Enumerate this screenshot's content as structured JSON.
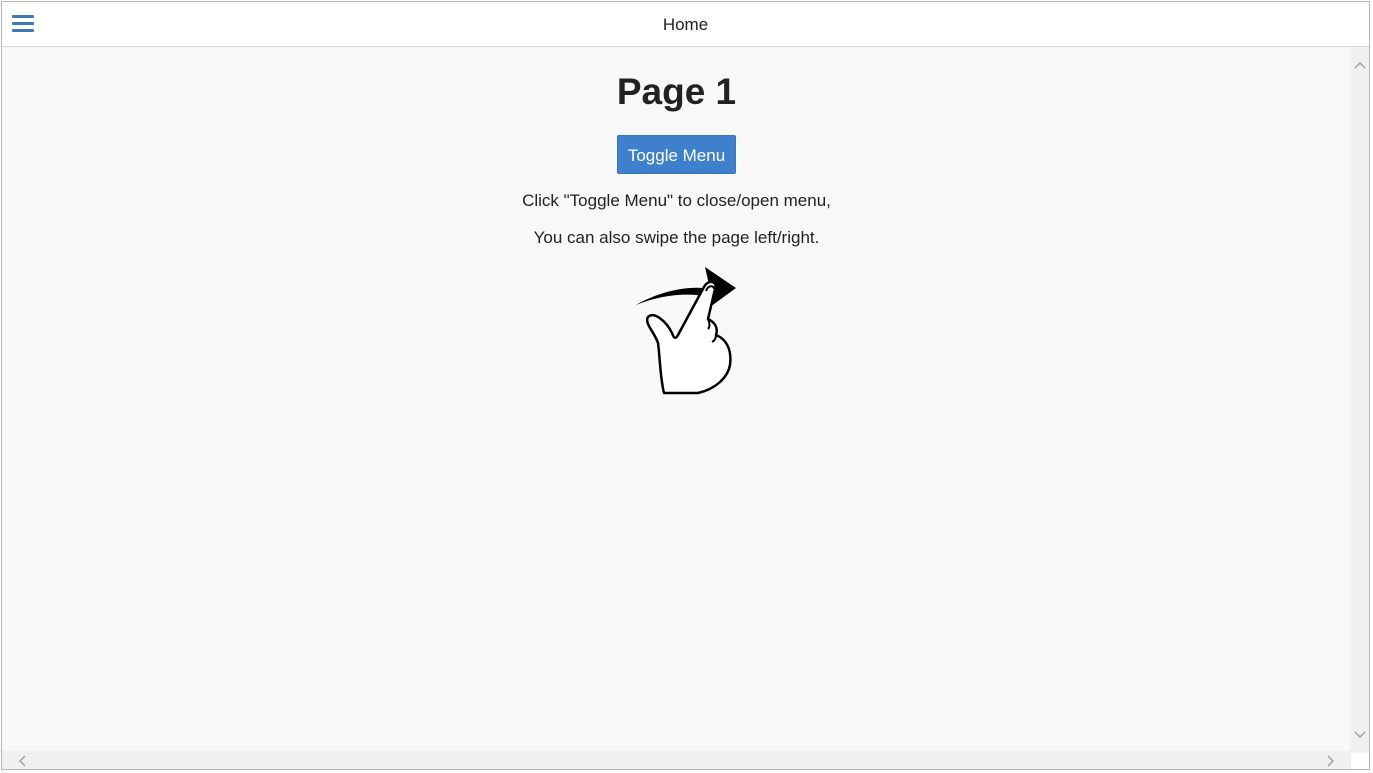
{
  "header": {
    "title": "Home",
    "menu_icon": "hamburger-menu-icon"
  },
  "main": {
    "heading": "Page 1",
    "toggle_button_label": "Toggle Menu",
    "instruction_line1": "Click \"Toggle Menu\" to close/open menu,",
    "instruction_line2": "You can also swipe the page left/right.",
    "illustration_icon": "swipe-gesture-icon"
  },
  "colors": {
    "accent": "#3f80cc",
    "menu_icon": "#3e7ab8",
    "content_background": "#f8f8f8"
  }
}
